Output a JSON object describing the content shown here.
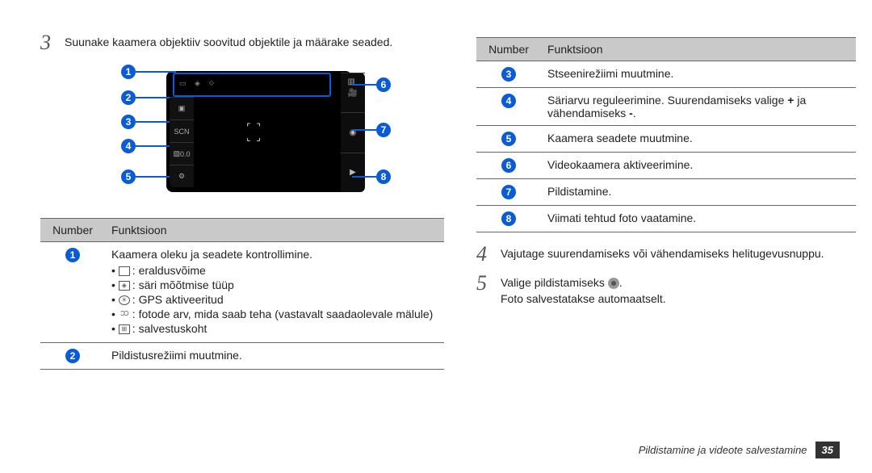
{
  "leftColumn": {
    "step3": "Suunake kaamera objektiiv soovitud objektile ja määrake seaded.",
    "tableHeader": {
      "num": "Number",
      "func": "Funktsioon"
    },
    "row1": {
      "title": "Kaamera oleku ja seadete kontrollimine.",
      "b1": ": eraldusvõime",
      "b2": ": säri mõõtmise tüüp",
      "b3": ": GPS aktiveeritud",
      "b4": ": fotode arv, mida saab teha (vastavalt saadaolevale mälule)",
      "b5": ": salvestuskoht"
    },
    "row2": "Pildistusrežiimi muutmine."
  },
  "rightColumn": {
    "tableHeader": {
      "num": "Number",
      "func": "Funktsioon"
    },
    "row3": "Stseenirežiimi muutmine.",
    "row4a": "Säriarvu reguleerimine. Suurendamiseks valige ",
    "row4plus": "+",
    "row4b": " ja vähendamiseks ",
    "row4minus": "-",
    "row4c": ".",
    "row5": "Kaamera seadete muutmine.",
    "row6": "Videokaamera aktiveerimine.",
    "row7": "Pildistamine.",
    "row8": "Viimati tehtud foto vaatamine.",
    "step4": "Vajutage suurendamiseks või vähendamiseks helitugevusnuppu.",
    "step5a": "Valige pildistamiseks ",
    "step5b": "Foto salvestatakse automaatselt."
  },
  "diagram": {
    "leftLabels": {
      "scn": "SCN",
      "ev": "0.0"
    }
  },
  "footer": {
    "title": "Pildistamine ja videote salvestamine",
    "page": "35"
  }
}
